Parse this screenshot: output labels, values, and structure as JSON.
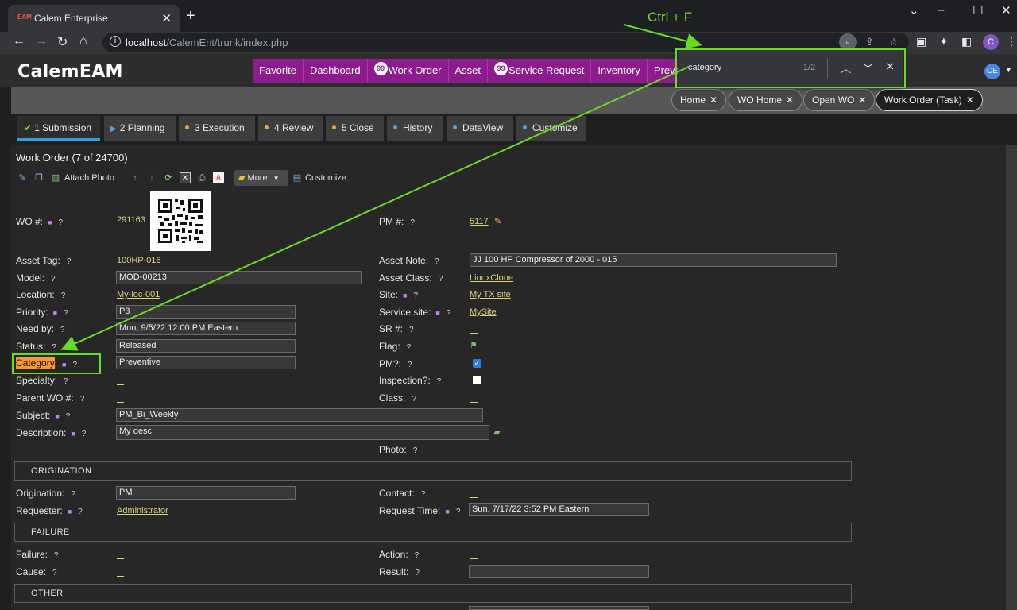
{
  "browser": {
    "tab_title": "Calem Enterprise",
    "favicon_text": "EAM",
    "url_host": "localhost",
    "url_path": "/CalemEnt/trunk/index.php",
    "profile_initial": "C"
  },
  "find": {
    "query": "category",
    "count": "1/2",
    "annotation": "Ctrl + F"
  },
  "app": {
    "logo": "CalemEAM",
    "user_initials": "CE",
    "menu": [
      {
        "label": "Favorite",
        "badge": ""
      },
      {
        "label": "Dashboard",
        "badge": ""
      },
      {
        "label": "Work Order",
        "badge": "99"
      },
      {
        "label": "Asset",
        "badge": ""
      },
      {
        "label": "Service Request",
        "badge": "99"
      },
      {
        "label": "Inventory",
        "badge": ""
      },
      {
        "label": "Preve",
        "badge": ""
      }
    ],
    "open_tabs": [
      "Home",
      "WO Home",
      "Open WO",
      "Work Order (Task)"
    ],
    "tab_close": "✕"
  },
  "workflow_tabs": [
    {
      "label": "1 Submission"
    },
    {
      "label": "2 Planning"
    },
    {
      "label": "3 Execution"
    },
    {
      "label": "4 Review"
    },
    {
      "label": "5 Close"
    },
    {
      "label": "History"
    },
    {
      "label": "DataView"
    },
    {
      "label": "Customize"
    }
  ],
  "form": {
    "title": "Work Order (7 of 24700)",
    "toolbar": {
      "attach_photo": "Attach Photo",
      "more": "More",
      "customize": "Customize"
    },
    "help_mark": "?",
    "wo_number": {
      "label": "WO #:",
      "value": "291163"
    },
    "pm_number": {
      "label": "PM #:",
      "value": "5117"
    },
    "asset_tag": {
      "label": "Asset Tag:",
      "value": "100HP-016"
    },
    "asset_note": {
      "label": "Asset Note:",
      "value": "JJ 100 HP Compressor of 2000 - 015"
    },
    "model": {
      "label": "Model:",
      "value": "MOD-00213"
    },
    "asset_class": {
      "label": "Asset Class:",
      "value": "LinuxClone"
    },
    "location": {
      "label": "Location:",
      "value": "My-loc-001"
    },
    "site": {
      "label": "Site:",
      "value": "My TX site"
    },
    "priority": {
      "label": "Priority:",
      "value": "P3"
    },
    "service_site": {
      "label": "Service site:",
      "value": "MySite"
    },
    "need_by": {
      "label": "Need by:",
      "value": "Mon, 9/5/22 12:00 PM Eastern"
    },
    "sr_number": {
      "label": "SR #:"
    },
    "status": {
      "label": "Status:",
      "value": "Released"
    },
    "flag": {
      "label": "Flag:"
    },
    "category": {
      "label_hl": "Category",
      "label_rest": ":",
      "value": "Preventive"
    },
    "pm_flag": {
      "label": "PM?:",
      "checked": true
    },
    "specialty": {
      "label": "Specialty:"
    },
    "inspection": {
      "label": "Inspection?:",
      "checked": false
    },
    "parent_wo": {
      "label": "Parent WO #:"
    },
    "class": {
      "label": "Class:"
    },
    "subject": {
      "label": "Subject:",
      "value": "PM_Bi_Weekly"
    },
    "description": {
      "label": "Description:",
      "value": "My desc"
    },
    "photo": {
      "label": "Photo:"
    }
  },
  "sections": {
    "origination": "ORIGINATION",
    "failure": "FAILURE",
    "other": "OTHER"
  },
  "origination": {
    "origination": {
      "label": "Origination:",
      "value": "PM"
    },
    "contact": {
      "label": "Contact:"
    },
    "requester": {
      "label": "Requester:",
      "value": "Administrator"
    },
    "request_time": {
      "label": "Request Time:",
      "value": "Sun, 7/17/22 3:52 PM Eastern"
    }
  },
  "failure": {
    "failure": {
      "label": "Failure:"
    },
    "action": {
      "label": "Action:"
    },
    "cause": {
      "label": "Cause:"
    },
    "result": {
      "label": "Result:"
    }
  },
  "colors": {
    "menu_bg": "#8e1b8e",
    "annotation": "#66dd22",
    "find_match": "#ff9632",
    "required_dot": "#c77dff",
    "link": "#d8d07a"
  }
}
